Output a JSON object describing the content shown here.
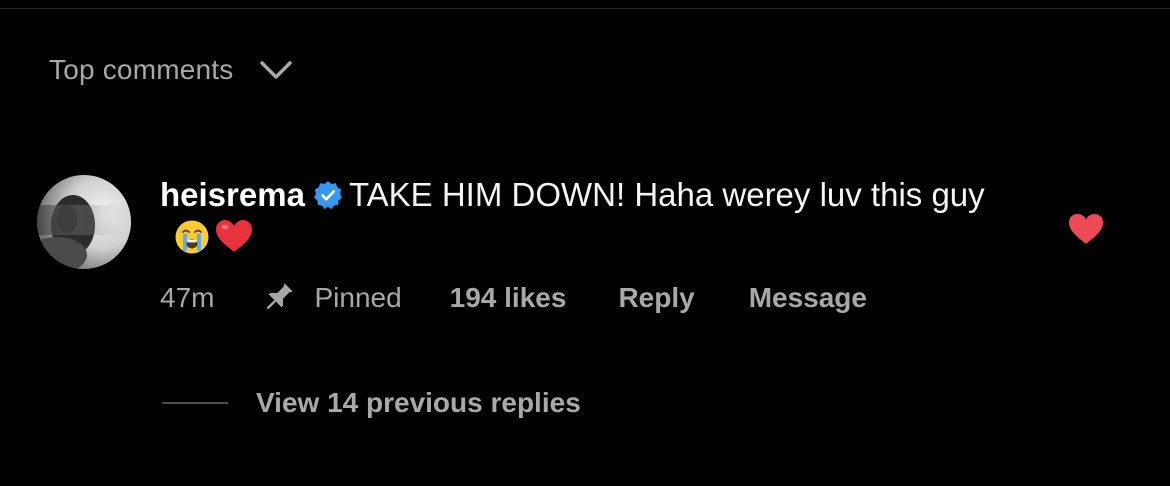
{
  "header": {
    "sort_label": "Top comments",
    "sort_icon": "chevron-down-icon"
  },
  "comment": {
    "username": "heisrema",
    "verified": true,
    "text": "TAKE HIM DOWN! Haha werey luv this guy",
    "emojis": [
      "loudly-crying-face",
      "red-heart"
    ],
    "time": "47m",
    "pinned_label": "Pinned",
    "likes_label": "194 likes",
    "reply_label": "Reply",
    "message_label": "Message",
    "liked": true
  },
  "replies": {
    "label": "View 14 previous replies"
  },
  "colors": {
    "background": "#000000",
    "primary_text": "#ffffff",
    "secondary_text": "#a8a8a8",
    "verified_blue": "#3897f0",
    "like_red": "#ed4956"
  }
}
